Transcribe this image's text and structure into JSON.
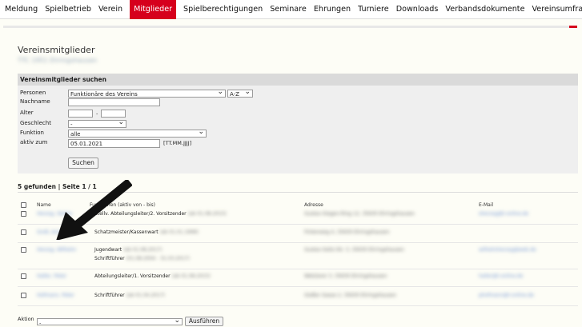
{
  "nav": [
    "Meldung",
    "Spielbetrieb",
    "Verein",
    "Mitglieder",
    "Spielberechtigungen",
    "Seminare",
    "Ehrungen",
    "Turniere",
    "Downloads",
    "Verbandsdokumente",
    "Vereinsumfragen"
  ],
  "nav_active": "Mitglieder",
  "page": {
    "title": "Vereinsmitglieder",
    "subtitle": "TTC 1951 Ehringshausen"
  },
  "search": {
    "heading": "Vereinsmitglieder suchen",
    "personen_label": "Personen",
    "personen_value": "Funktionäre des Vereins",
    "az_value": "A-Z",
    "nachname_label": "Nachname",
    "alter_label": "Alter",
    "alter_sep": "-",
    "geschlecht_label": "Geschlecht",
    "geschlecht_value": "-",
    "funktion_label": "Funktion",
    "funktion_value": "alle",
    "aktiv_label": "aktiv zum",
    "aktiv_value": "05.01.2021",
    "aktiv_hint": "[TT.MM.JJJJ]",
    "button": "Suchen"
  },
  "results": {
    "summary": "5 gefunden | Seite 1 / 1",
    "headers": {
      "name": "Name",
      "funktion": "Funktionen (aktiv von - bis)",
      "adresse": "Adresse",
      "email": "E-Mail"
    },
    "rows": [
      {
        "name": "Herzog, Stefan",
        "functions": [
          {
            "title": "Stellv. Abteilungsleiter/2. Vorsitzender",
            "date": "(ab 01.08.2015)"
          }
        ],
        "address": "Gustav-Siegen-Ring 12, 35630 Ehringshausen",
        "email": "sherzog@t-online.de"
      },
      {
        "name": "Groß, Andreas",
        "functions": [
          {
            "title": "Schatzmeister/Kassenwart",
            "date": "(ab 01.01.1999)"
          }
        ],
        "address": "Finkenweg 4, 35630 Ehringshausen",
        "email": ""
      },
      {
        "name": "Herzog, Wilhelm",
        "functions": [
          {
            "title": "Jugendwart",
            "date": "(ab 01.08.2017)"
          },
          {
            "title": "Schriftführer",
            "date": "(01.08.2004 - 31.03.2017)"
          }
        ],
        "address": "Gustav-Seitz-Str. 3, 35630 Ehringshausen",
        "email": "wilhelmherzog@web.de"
      },
      {
        "name": "Haller, Peter",
        "functions": [
          {
            "title": "Abteilungsleiter/1. Vorsitzender",
            "date": "(ab 01.08.2015)"
          }
        ],
        "address": "Wetzlarer 3, 35630 Ehringshausen",
        "email": "haller@t-online.de"
      },
      {
        "name": "Hofmann, Peter",
        "functions": [
          {
            "title": "Schriftführer",
            "date": "(ab 01.04.2017)"
          }
        ],
        "address": "Gießer Gasse 2, 35630 Ehringshausen",
        "email": "phofmann@t-online.de"
      }
    ]
  },
  "action": {
    "label": "Aktion",
    "select_value": "-",
    "button": "Ausführen"
  }
}
